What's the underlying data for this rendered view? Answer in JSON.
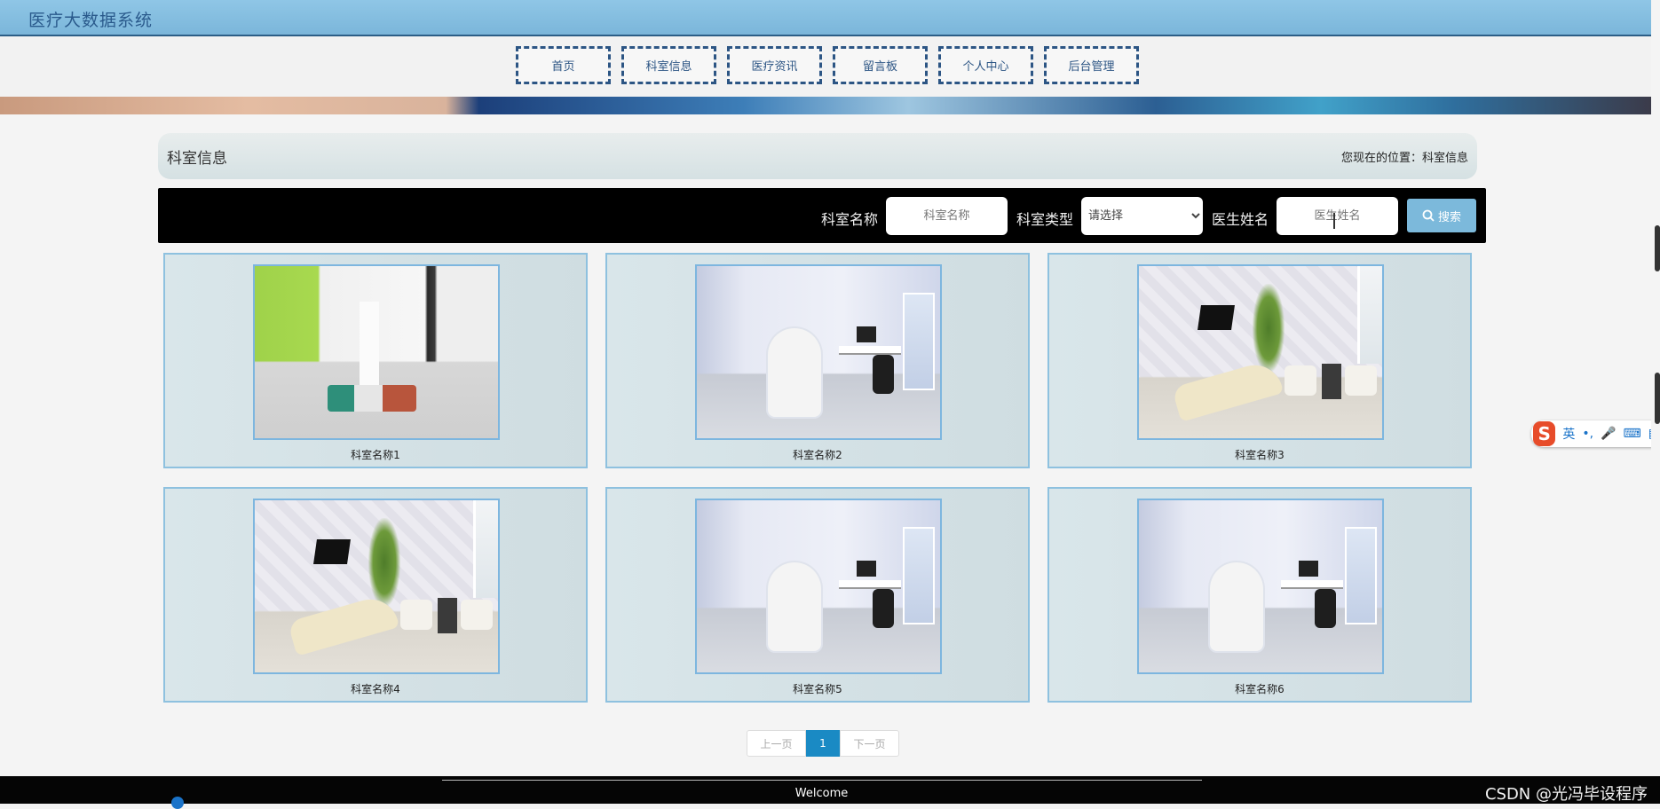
{
  "header": {
    "site_title": "医疗大数据系统"
  },
  "nav": [
    {
      "label": "首页"
    },
    {
      "label": "科室信息"
    },
    {
      "label": "医疗资讯"
    },
    {
      "label": "留言板"
    },
    {
      "label": "个人中心"
    },
    {
      "label": "后台管理"
    }
  ],
  "crumb": {
    "section_title": "科室信息",
    "location": "您现在的位置：科室信息"
  },
  "search": {
    "dept_name_label": "科室名称",
    "dept_name_placeholder": "科室名称",
    "dept_type_label": "科室类型",
    "dept_type_selected": "请选择",
    "doctor_label": "医生姓名",
    "doctor_placeholder": "医生姓名",
    "button_label": "搜索"
  },
  "departments": [
    {
      "name": "科室名称1",
      "photo": "waiting-hall"
    },
    {
      "name": "科室名称2",
      "photo": "dental-room"
    },
    {
      "name": "科室名称3",
      "photo": "dental-room-plant"
    },
    {
      "name": "科室名称4",
      "photo": "dental-room-plant"
    },
    {
      "name": "科室名称5",
      "photo": "dental-room"
    },
    {
      "name": "科室名称6",
      "photo": "dental-room"
    }
  ],
  "pagination": {
    "prev": "上一页",
    "current": "1",
    "next": "下一页"
  },
  "footer": {
    "welcome": "Welcome",
    "watermark": "CSDN @光冯毕设程序"
  },
  "ime": {
    "logo": "S",
    "lang": "英",
    "punct": "•,",
    "mic": "🎤",
    "keyboard": "⌨",
    "grid": "▦"
  },
  "colors": {
    "header_bg": "#8fc6e6",
    "nav_border": "#2c5584",
    "search_btn": "#7cb9db",
    "page_active": "#1a8ac4"
  }
}
